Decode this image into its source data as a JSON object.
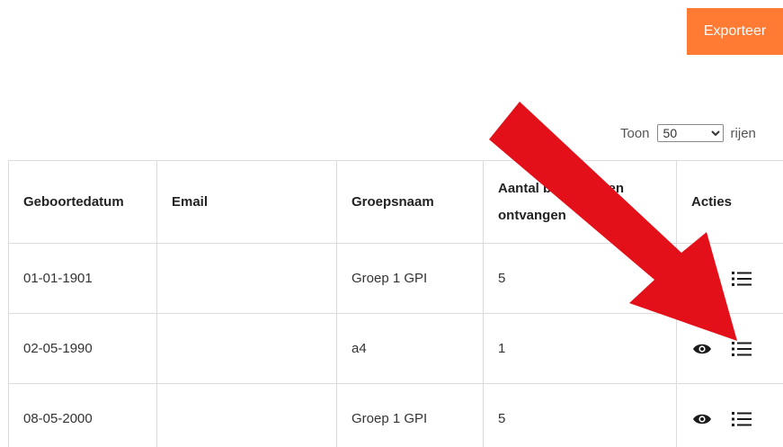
{
  "toolbar": {
    "export_label": "Exporteer"
  },
  "pagination": {
    "prefix": "Toon",
    "selected": "50",
    "suffix": "rijen"
  },
  "table": {
    "columns": [
      "Geboortedatum",
      "Email",
      "Groepsnaam",
      "Aantal berichtingen ontvangen",
      "Acties"
    ],
    "rows": [
      {
        "birthdate": "01-01-1901",
        "email": "",
        "group": "Groep 1 GPI",
        "count": "5"
      },
      {
        "birthdate": "02-05-1990",
        "email": "",
        "group": "a4",
        "count": "1"
      },
      {
        "birthdate": "08-05-2000",
        "email": "",
        "group": "Groep 1 GPI",
        "count": "5"
      }
    ]
  },
  "icons": {
    "view": "eye-icon",
    "list": "list-icon"
  },
  "colors": {
    "accent": "#ff7a33",
    "arrow": "#e3101a",
    "border": "#dcdcdc"
  }
}
